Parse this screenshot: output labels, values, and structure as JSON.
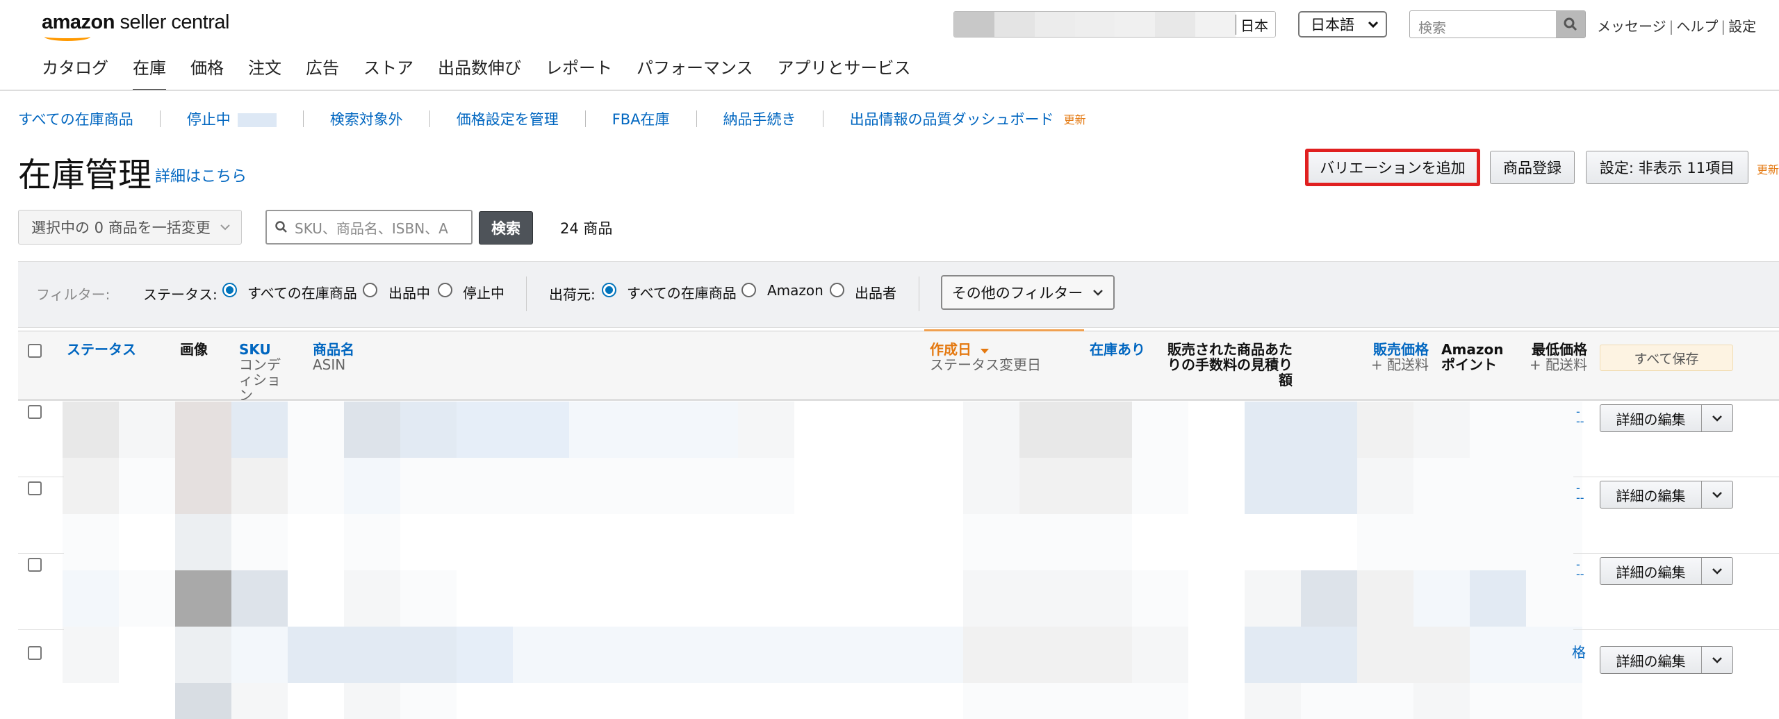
{
  "header": {
    "logo": {
      "brand": "amazon",
      "product": "seller central"
    },
    "marketplace": "日本",
    "language": "日本語",
    "search_placeholder": "検索",
    "links": [
      "メッセージ",
      "ヘルプ",
      "設定"
    ]
  },
  "main_nav": [
    "カタログ",
    "在庫",
    "価格",
    "注文",
    "広告",
    "ストア",
    "出品数伸び",
    "レポート",
    "パフォーマンス",
    "アプリとサービス"
  ],
  "main_nav_active": "在庫",
  "sub_nav": {
    "all_inventory": "すべての在庫商品",
    "inactive": "停止中",
    "suppressed": "検索対象外",
    "manage_pricing": "価格設定を管理",
    "fba": "FBA在庫",
    "shipments": "納品手続き",
    "quality_dashboard": "出品情報の品質ダッシュボード",
    "new_badge": "更新"
  },
  "page": {
    "title": "在庫管理",
    "learn_more": "詳細はこちら",
    "add_variation": "バリエーションを追加",
    "add_product": "商品登録",
    "settings": "設定: 非表示 11項目",
    "update": "更新"
  },
  "actions": {
    "bulk_select": "選択中の 0 商品を一括変更",
    "sku_search_placeholder": "SKU、商品名、ISBN、A",
    "search_button": "検索",
    "count": "24 商品"
  },
  "filters": {
    "label": "フィルター:",
    "status_label": "ステータス:",
    "status_options": [
      "すべての在庫商品",
      "出品中",
      "停止中"
    ],
    "status_selected": 0,
    "fulfillment_label": "出荷元:",
    "fulfillment_options": [
      "すべての在庫商品",
      "Amazon",
      "出品者"
    ],
    "fulfillment_selected": 0,
    "more_filters": "その他のフィルター"
  },
  "table": {
    "headers": {
      "status": "ステータス",
      "image": "画像",
      "sku": "SKU",
      "condition": "コンディション",
      "product_name": "商品名",
      "asin": "ASIN",
      "created": "作成日",
      "status_changed": "ステータス変更日",
      "available": "在庫あり",
      "fee_estimate": "販売された商品あたりの手数料の見積り額",
      "price": "販売価格",
      "shipping": "+ 配送料",
      "amazon_points": "Amazon ポイント",
      "lowest_price": "最低価格",
      "save_all": "すべて保存"
    },
    "row_action": "詳細の編集",
    "row_price_link": "格",
    "row_dash": "-",
    "row_double_dash": "--"
  },
  "colors": {
    "link": "#0066c0",
    "accent": "#e47911",
    "highlight_border": "#e02020",
    "radio": "#0073bb"
  }
}
